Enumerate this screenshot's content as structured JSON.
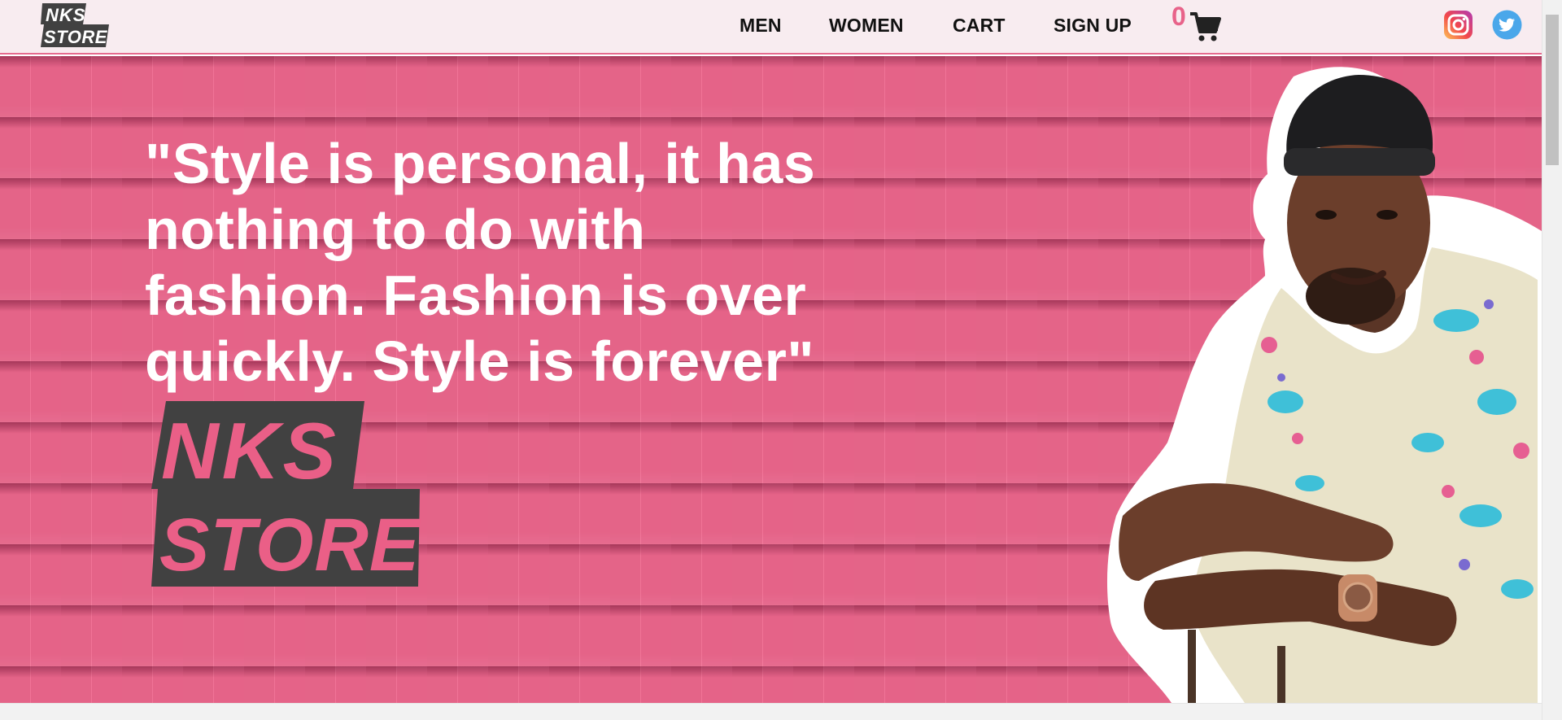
{
  "brand": {
    "name_line1": "NKS",
    "name_line2": "STORE"
  },
  "nav": {
    "items": [
      {
        "label": "MEN"
      },
      {
        "label": "WOMEN"
      },
      {
        "label": "CART"
      },
      {
        "label": "SIGN UP"
      }
    ],
    "cart_count": "0",
    "cart_icon": "shopping-cart-icon",
    "social": [
      {
        "icon": "instagram-icon"
      },
      {
        "icon": "twitter-icon"
      }
    ]
  },
  "hero": {
    "quote": "\"Style is personal, it has nothing to do with fashion. Fashion is over quickly. Style is forever\"",
    "image": "model-photo"
  },
  "colors": {
    "accent_pink": "#e8638a",
    "header_bg": "#f8ecf0",
    "logo_gray": "#414141"
  }
}
